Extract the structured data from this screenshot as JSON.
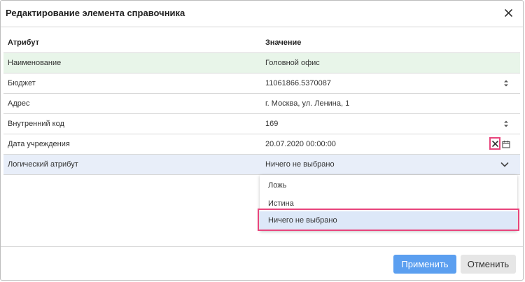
{
  "dialog": {
    "title": "Редактирование элемента справочника",
    "close_icon": "close-icon"
  },
  "table": {
    "columns": [
      "Атрибут",
      "Значение"
    ],
    "rows": [
      {
        "attribute": "Наименование",
        "value": "Головной офис"
      },
      {
        "attribute": "Бюджет",
        "value": "11061866.5370087"
      },
      {
        "attribute": "Адрес",
        "value": "г. Москва, ул. Ленина, 1"
      },
      {
        "attribute": "Внутренний код",
        "value": "169"
      },
      {
        "attribute": "Дата учреждения",
        "value": "20.07.2020 00:00:00"
      },
      {
        "attribute": "Логический атрибут",
        "value": "Ничего не выбрано"
      }
    ]
  },
  "dropdown": {
    "options": [
      "Ложь",
      "Истина",
      "Ничего не выбрано"
    ],
    "selected": "Ничего не выбрано"
  },
  "footer": {
    "apply_label": "Применить",
    "cancel_label": "Отменить"
  },
  "colors": {
    "accent": "#5b9ff0",
    "highlight": "#e8457c",
    "row_green": "#e8f5e9",
    "row_blue": "#e8eef9"
  }
}
